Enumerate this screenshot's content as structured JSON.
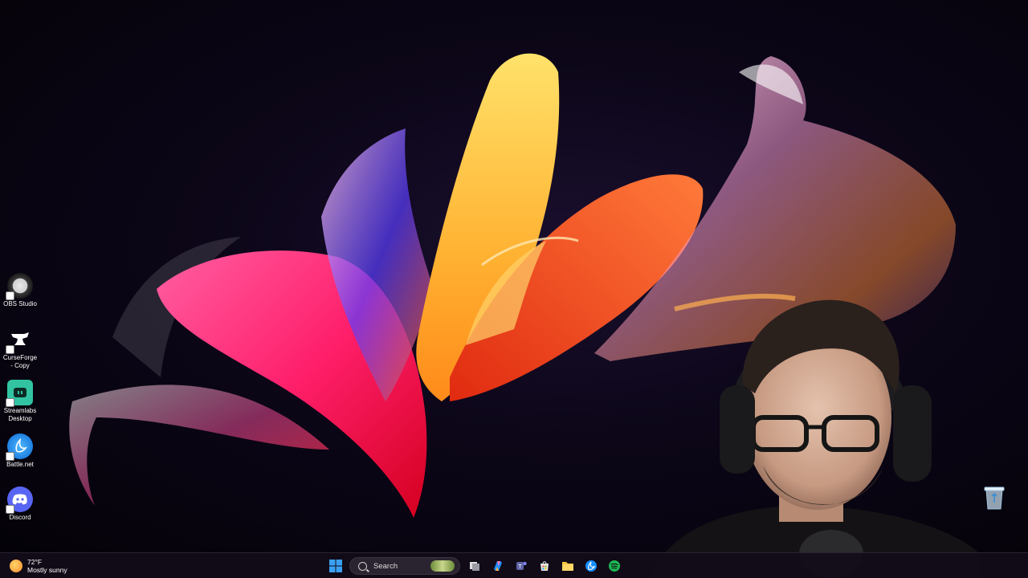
{
  "desktop": {
    "icons": [
      {
        "label": "OBS Studio",
        "icon": "obs-icon"
      },
      {
        "label": "CurseForge - Copy",
        "icon": "curseforge-icon"
      },
      {
        "label": "Streamlabs Desktop",
        "icon": "streamlabs-icon"
      },
      {
        "label": "Battle.net",
        "icon": "battlenet-icon"
      },
      {
        "label": "Discord",
        "icon": "discord-icon"
      }
    ],
    "recycle_bin_icon": "recycle-bin-icon"
  },
  "taskbar": {
    "weather": {
      "temperature": "72°F",
      "condition": "Mostly sunny",
      "icon": "weather-sun-icon"
    },
    "start_icon": "windows-start-icon",
    "search": {
      "placeholder": "Search"
    },
    "pinned": [
      {
        "icon": "task-view-icon"
      },
      {
        "icon": "copilot-icon"
      },
      {
        "icon": "teams-icon"
      },
      {
        "icon": "store-icon"
      },
      {
        "icon": "file-explorer-icon"
      },
      {
        "icon": "battlenet-taskbar-icon"
      },
      {
        "icon": "spotify-icon"
      }
    ],
    "colors": {
      "windows_blue": "#3aa0f5",
      "spotify_green": "#1db954",
      "discord": "#5865f2",
      "streamlabs": "#31c3a2"
    }
  }
}
